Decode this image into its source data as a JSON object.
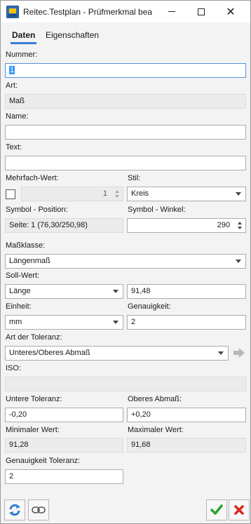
{
  "window": {
    "title": "Reitec.Testplan - Prüfmerkmal bearb..."
  },
  "tabs": [
    {
      "label": "Daten"
    },
    {
      "label": "Eigenschaften"
    }
  ],
  "fields": {
    "nummer": {
      "label": "Nummer:",
      "value": "1"
    },
    "art": {
      "label": "Art:",
      "value": "Maß"
    },
    "name": {
      "label": "Name:",
      "value": ""
    },
    "text": {
      "label": "Text:",
      "value": ""
    },
    "mehrfach": {
      "label": "Mehrfach-Wert:",
      "checked": false,
      "value": "1"
    },
    "stil": {
      "label": "Stil:",
      "value": "Kreis"
    },
    "symbol_position": {
      "label": "Symbol - Position:",
      "value": "Seite: 1 (76,30/250,98)"
    },
    "symbol_winkel": {
      "label": "Symbol - Winkel:",
      "value": "290"
    },
    "massklasse": {
      "label": "Maßklasse:",
      "value": "Längenmaß"
    },
    "soll_wert": {
      "label": "Soll-Wert:",
      "type_value": "Länge",
      "value": "91,48"
    },
    "einheit": {
      "label": "Einheit:",
      "value": "mm"
    },
    "genauigkeit": {
      "label": "Genauigkeit:",
      "value": "2"
    },
    "art_toleranz": {
      "label": "Art der Toleranz:",
      "value": "Unteres/Oberes Abmaß"
    },
    "iso": {
      "label": "ISO:",
      "value": ""
    },
    "untere_toleranz": {
      "label": "Untere Toleranz:",
      "value": "-0,20"
    },
    "oberes_abmass": {
      "label": "Oberes Abmaß:",
      "value": "+0,20"
    },
    "minimaler_wert": {
      "label": "Minimaler Wert:",
      "value": "91,28"
    },
    "maximaler_wert": {
      "label": "Maximaler Wert:",
      "value": "91,68"
    },
    "genauigkeit_toleranz": {
      "label": "Genauigkeit Toleranz:",
      "value": "2"
    }
  },
  "icons": {
    "app": "app-icon",
    "refresh": "refresh-icon",
    "link": "link-icon",
    "ok": "checkmark-icon",
    "cancel": "cross-icon",
    "apply": "arrow-right-icon"
  },
  "colors": {
    "ok": "#2aa52a",
    "cancel": "#d9261c",
    "refresh": "#2f7fd1",
    "accent": "#3a7bd5"
  }
}
